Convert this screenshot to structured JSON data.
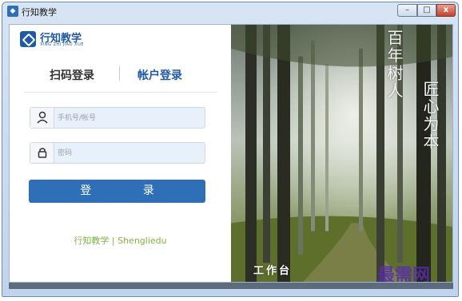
{
  "window": {
    "title": "行知教学",
    "controls": {
      "minimize": "–",
      "maximize": "□",
      "close": "x"
    }
  },
  "logo": {
    "name": "行知教学",
    "subtitle": "XING ZHI JIAO XUE"
  },
  "tabs": [
    {
      "label": "扫码登录",
      "active": false
    },
    {
      "label": "帐户登录",
      "active": true
    }
  ],
  "form": {
    "phone": {
      "placeholder": "手机号/帐号",
      "value": "",
      "icon": "user-icon"
    },
    "password": {
      "placeholder": "密码",
      "value": "",
      "icon": "lock-icon"
    },
    "submit_label": "登 录"
  },
  "footer": {
    "brand": "行知教学",
    "company": "Shengliedu"
  },
  "banner": {
    "poem_line_1": "百年树人",
    "poem_line_2": "匠心为本",
    "workbench": "工作台",
    "watermark": "最需网"
  },
  "colors": {
    "brand_blue": "#2f6fb7",
    "footer_green": "#7cb342",
    "watermark_purple": "#5a2bb0"
  }
}
